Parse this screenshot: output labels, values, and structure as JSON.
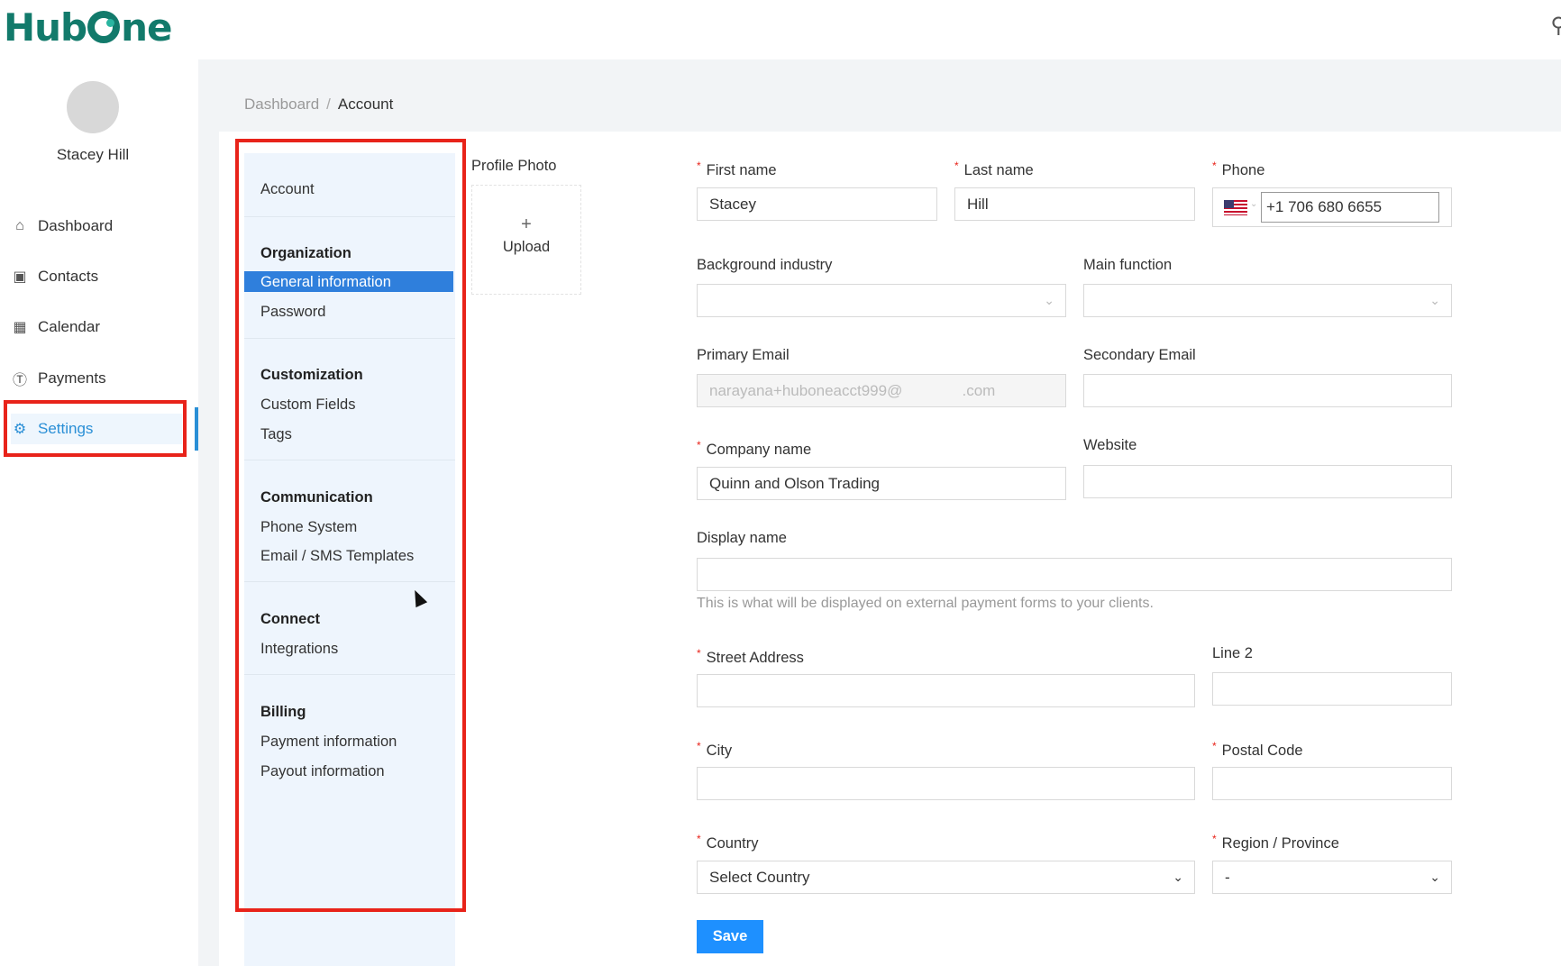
{
  "brand": {
    "logo_text_a": "Hub",
    "logo_text_b": "ne"
  },
  "user": {
    "name": "Stacey Hill"
  },
  "sidebar": {
    "items": [
      {
        "label": "Dashboard",
        "icon": "home-icon"
      },
      {
        "label": "Contacts",
        "icon": "contacts-icon"
      },
      {
        "label": "Calendar",
        "icon": "calendar-icon"
      },
      {
        "label": "Payments",
        "icon": "dollar-icon"
      },
      {
        "label": "Settings",
        "icon": "gear-icon",
        "active": true
      }
    ]
  },
  "breadcrumb": {
    "parent": "Dashboard",
    "separator": "/",
    "current": "Account"
  },
  "submenu": {
    "account": "Account",
    "organization": {
      "heading": "Organization",
      "items": [
        "General information",
        "Password"
      ]
    },
    "customization": {
      "heading": "Customization",
      "items": [
        "Custom Fields",
        "Tags"
      ]
    },
    "communication": {
      "heading": "Communication",
      "items": [
        "Phone System",
        "Email / SMS Templates"
      ]
    },
    "connect": {
      "heading": "Connect",
      "items": [
        "Integrations"
      ]
    },
    "billing": {
      "heading": "Billing",
      "items": [
        "Payment information",
        "Payout information"
      ]
    },
    "active_item": "General information"
  },
  "profile_photo": {
    "label": "Profile Photo",
    "upload_icon": "+",
    "upload_label": "Upload"
  },
  "form": {
    "first_name": {
      "label": "First name",
      "value": "Stacey",
      "required": true
    },
    "last_name": {
      "label": "Last name",
      "value": "Hill",
      "required": true
    },
    "phone": {
      "label": "Phone",
      "value": "+1 706 680 6655",
      "required": true,
      "country_flag": "us-flag-icon"
    },
    "background_industry": {
      "label": "Background industry",
      "value": ""
    },
    "main_function": {
      "label": "Main function",
      "value": ""
    },
    "primary_email": {
      "label": "Primary Email",
      "value": "narayana+huboneacct999@              .com",
      "disabled": true
    },
    "secondary_email": {
      "label": "Secondary Email",
      "value": ""
    },
    "company_name": {
      "label": "Company name",
      "value": "Quinn and Olson Trading",
      "required": true
    },
    "website": {
      "label": "Website",
      "value": ""
    },
    "display_name": {
      "label": "Display name",
      "value": "",
      "hint": "This is what will be displayed on external payment forms to your clients."
    },
    "street_address": {
      "label": "Street Address",
      "value": "",
      "required": true
    },
    "line2": {
      "label": "Line 2",
      "value": ""
    },
    "city": {
      "label": "City",
      "value": "",
      "required": true
    },
    "postal_code": {
      "label": "Postal Code",
      "value": "",
      "required": true
    },
    "country": {
      "label": "Country",
      "value": "Select Country",
      "required": true
    },
    "region": {
      "label": "Region / Province",
      "value": "-",
      "required": true
    },
    "save_label": "Save"
  },
  "colors": {
    "accent": "#1e90ff",
    "brand": "#127a6b",
    "highlight": "#e8231a",
    "required": "#e8231a"
  }
}
